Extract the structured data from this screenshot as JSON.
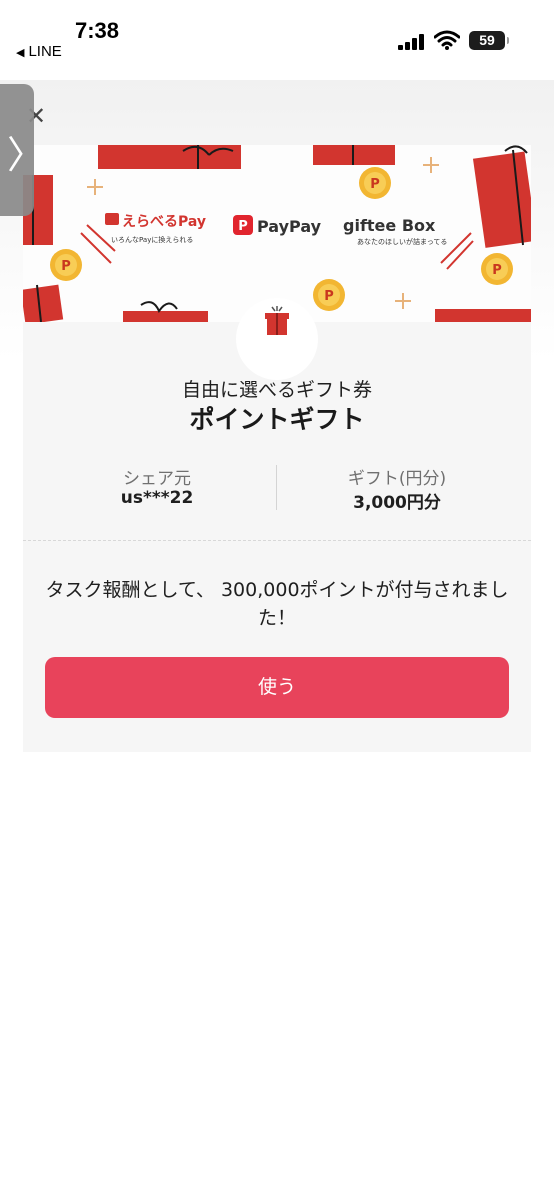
{
  "status_bar": {
    "time": "7:38",
    "back_app_label": "LINE",
    "back_icon": "back-triangle-icon",
    "battery_level": "59"
  },
  "nav": {
    "close_icon": "close-icon",
    "side_tab_icon": "chevron-right-icon"
  },
  "banner": {
    "brands": [
      {
        "name": "えらべるPay",
        "tagline": "いろんなPayに換えられる"
      },
      {
        "name": "PayPay"
      },
      {
        "name": "giftee Box",
        "tagline": "あなたのほしいが詰まってる"
      }
    ],
    "colors": {
      "gift_red": "#d2352f",
      "coin_gold": "#f2b632"
    }
  },
  "gift": {
    "subtitle": "自由に選べるギフト券",
    "title": "ポイントギフト",
    "sharer_label": "シェア元",
    "sharer_value": "us***22",
    "amount_label": "ギフト(円分)",
    "amount_value": "3,000円分"
  },
  "message": "タスク報酬として、 300,000ポイントが付与されました！",
  "actions": {
    "use_label": "使う",
    "accent_color": "#e8435b"
  }
}
